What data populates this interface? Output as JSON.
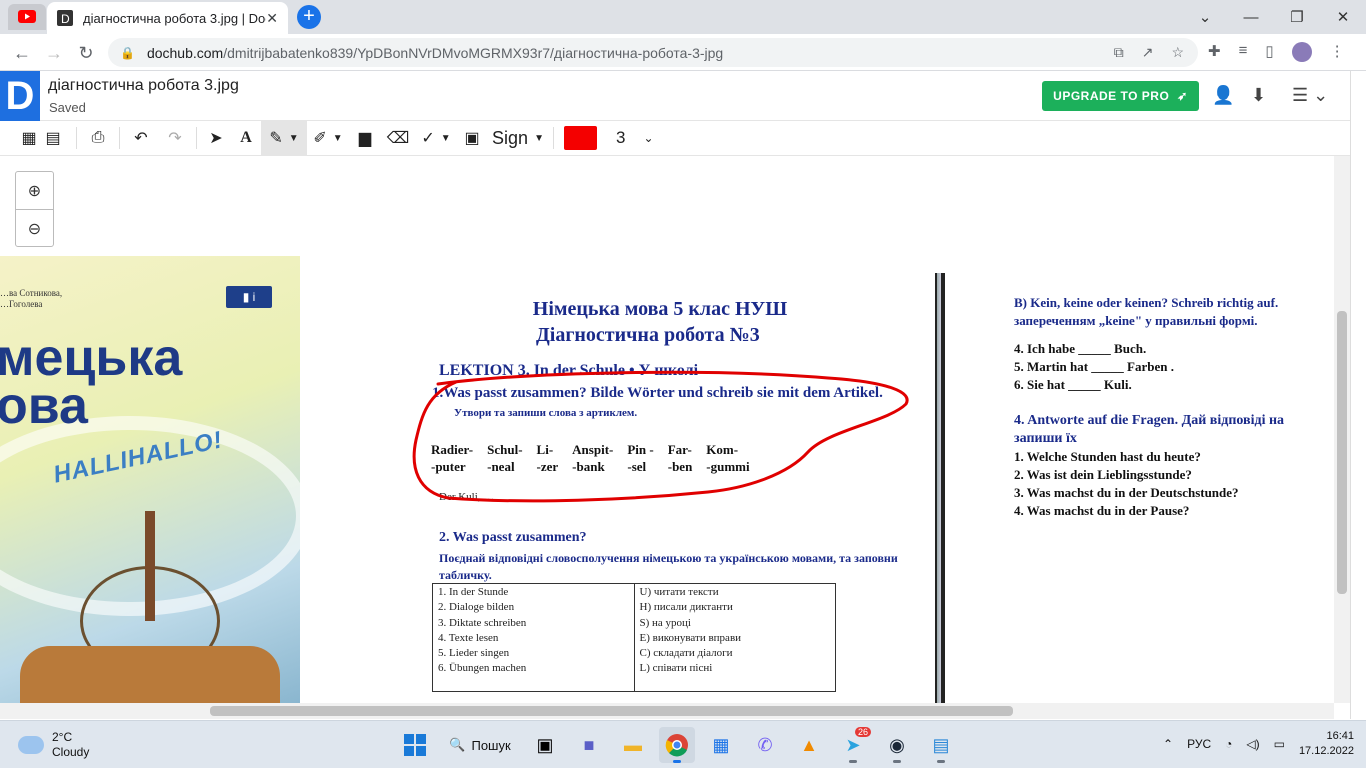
{
  "browser": {
    "tab_title": "діагностична робота 3.jpg | Doc",
    "url_domain": "dochub.com",
    "url_path": "/dmitrijbabatenko839/YpDBonNVrDMvoMGRMX93r7/діагностична-робота-3-jpg"
  },
  "dochub": {
    "logo": "D",
    "doc_title": "діагностична робота 3.jpg",
    "status": "Saved",
    "upgrade_label": "UPGRADE TO PRO",
    "sign_label": "Sign",
    "stroke_size": "3",
    "pen_color": "#f40000"
  },
  "cover": {
    "authors": "…ва Сотникова,\n…Гоголева",
    "title": "мецька\nова",
    "slogan": "HALLIHALLO!"
  },
  "doc": {
    "h1": "Німецька мова 5 клас НУШ",
    "h2": "Діагностична робота №3",
    "lektion": "LEKTION 3.   In der Schule   • У школі",
    "q1": "1.Was passt zusammen? Bilde Wörter und schreib sie mit dem Artikel.",
    "q1_uk": "Утвори та запиши слова з артиклем.",
    "parts": [
      {
        "top": "Radier-",
        "bottom": "-puter"
      },
      {
        "top": "Schul-",
        "bottom": "-neal"
      },
      {
        "top": "Li-",
        "bottom": "-zer"
      },
      {
        "top": "Anspit-",
        "bottom": "-bank"
      },
      {
        "top": "Pin -",
        "bottom": "-sel"
      },
      {
        "top": "Far-",
        "bottom": "-ben"
      },
      {
        "top": "Kom-",
        "bottom": "-gummi"
      }
    ],
    "example": "Der Kuli, …",
    "q2": "2. Was passt zusammen?",
    "q2_sub": "Поєднай відповідні словосполучення німецькою та українською мовами,  та заповни табличку.",
    "table": [
      [
        "1. In der Stunde",
        "U) читати тексти"
      ],
      [
        "2. Dialoge bilden",
        "H) писали диктанти"
      ],
      [
        "3. Diktate schreiben",
        "S) на уроці"
      ],
      [
        "4. Texte lesen",
        "E) виконувати вправи"
      ],
      [
        "5. Lieder singen",
        "C) складати діалоги"
      ],
      [
        "6. Übungen machen",
        "L) співати пісні"
      ]
    ],
    "right": {
      "b_title": "B) Kein, keine oder keinen? Schreib richtig auf.",
      "b_sub": "запереченням „keine\" у правильні формі.",
      "b_items": [
        "4. Ich habe _____  Buch.",
        "5. Martin hat _____  Farben .",
        "6.  Sie hat _____  Kuli."
      ],
      "q4_title": "4. Antworte auf die Fragen. Дай відповіді на запиши їх",
      "q4_items": [
        "1. Welche Stunden hast du heute?",
        "2. Was ist dein Lieblingsstunde?",
        "3. Was machst du in der Deutschstunde?",
        "4. Was machst du in der Pause?"
      ]
    }
  },
  "taskbar": {
    "temp": "2°C",
    "weather": "Cloudy",
    "search": "Пошук",
    "telegram_badge": "26",
    "lang": "РУС",
    "time": "16:41",
    "date": "17.12.2022"
  }
}
